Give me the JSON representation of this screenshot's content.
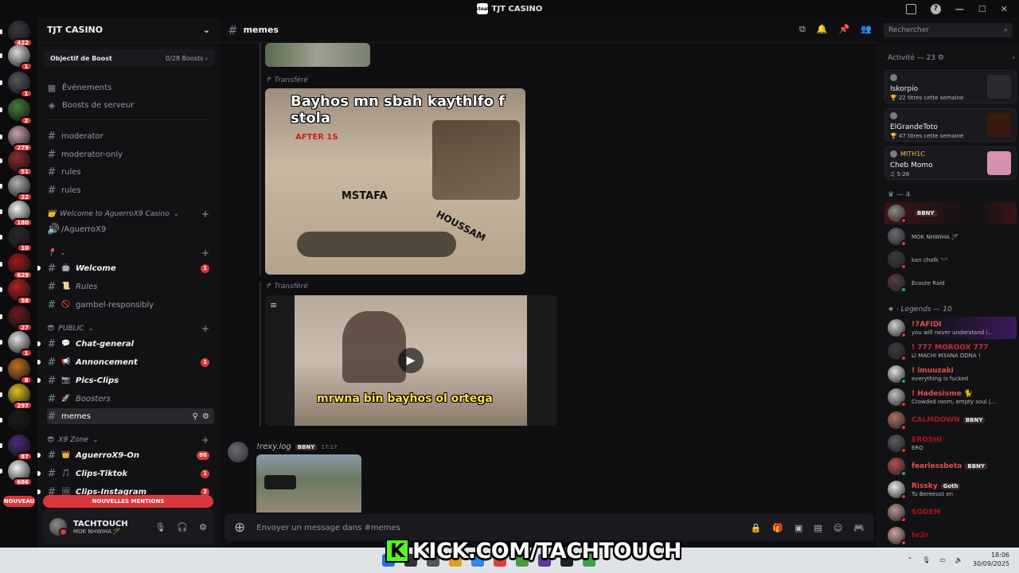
{
  "window": {
    "title": "TJT CASINO"
  },
  "rail": {
    "servers": [
      {
        "badge": "422",
        "color": "#3a3a40"
      },
      {
        "badge": "1",
        "color": "#d9d9d9"
      },
      {
        "badge": "1",
        "color": "#555560"
      },
      {
        "badge": "2",
        "color": "#4a7a3a"
      },
      {
        "badge": "279",
        "color": "#c9a0b0"
      },
      {
        "badge": "51",
        "color": "#8a2a2a"
      },
      {
        "badge": "22",
        "color": "#b0b0b0"
      },
      {
        "badge": "180",
        "color": "#f0f0f0"
      },
      {
        "badge": "10",
        "color": "#2a2a2a"
      },
      {
        "badge": "629",
        "color": "#a01818"
      },
      {
        "badge": "58",
        "color": "#b02020"
      },
      {
        "badge": "27",
        "color": "#6a1a1a"
      },
      {
        "badge": "1",
        "color": "#e0e0e0"
      },
      {
        "badge": "8",
        "color": "#c07020"
      },
      {
        "badge": "297",
        "color": "#e0c020"
      },
      {
        "badge": "",
        "color": "#1a1a1a"
      },
      {
        "badge": "87",
        "color": "#4a2a7a"
      },
      {
        "badge": "686",
        "color": "#f2f2f2"
      }
    ],
    "nouveau": "NOUVEAU"
  },
  "sidebar": {
    "server_name": "TJT CASINO",
    "boost": {
      "label": "Objectif de Boost",
      "count": "0/28 Boosts"
    },
    "nav": [
      {
        "label": "Événements"
      },
      {
        "label": "Boosts de serveur"
      }
    ],
    "channels_top": [
      {
        "label": "moderator"
      },
      {
        "label": "moderator-only"
      },
      {
        "label": "rules"
      },
      {
        "label": "rules"
      }
    ],
    "cat1": "Welcome to AguerroX9 Casino",
    "voice1": "/AguerroX9",
    "cat2_emoji": "📍",
    "group2": [
      {
        "emoji": "🤖",
        "label": "Welcome",
        "badge": "1"
      },
      {
        "emoji": "📜",
        "label": "Rules",
        "badge": ""
      },
      {
        "emoji": "🚫",
        "label": "gambel-responsibly",
        "badge": ""
      }
    ],
    "cat3": "PUBLIC",
    "group3": [
      {
        "emoji": "💬",
        "label": "Chat-general",
        "badge": ""
      },
      {
        "emoji": "📢",
        "label": "Annoncement",
        "badge": "1"
      },
      {
        "emoji": "📷",
        "label": "Pics-Clips",
        "badge": ""
      },
      {
        "emoji": "🚀",
        "label": "Boosters",
        "badge": ""
      }
    ],
    "active_channel": "memes",
    "cat4": "X9 Zone",
    "group4": [
      {
        "emoji": "👑",
        "label": "AguerroX9-On",
        "badge": "86"
      },
      {
        "emoji": "🎵",
        "label": "Clips-Tiktok",
        "badge": "1"
      },
      {
        "emoji": "🖼",
        "label": "Clips-Instagram",
        "badge": "2"
      }
    ],
    "mentions": "NOUVELLES MENTIONS",
    "user": {
      "name": "TACHTOUCH",
      "status": "MOK NHWIHA 🪄"
    }
  },
  "header": {
    "channel": "memes",
    "search_placeholder": "Rechercher"
  },
  "messages": {
    "forwarded_label": "Transféré",
    "meme1_caption_top": "Bayhos mn sbah kaythlfo f stola",
    "meme1_after": "AFTER 1S",
    "meme1_mstafa": "MSTAFA",
    "meme1_houssam": "HOUSSAM",
    "meme2_caption": "mrwna bin bayhos ol ortega",
    "author": "!rexy.log",
    "author_tag": "BBNY",
    "time": "17:17"
  },
  "composer": {
    "placeholder": "Envoyer un message dans #memes"
  },
  "members": {
    "activity_head": "Activité — 23",
    "activities": [
      {
        "user": "",
        "game": "Iskorpio",
        "sub": "22 titres cette semaine",
        "art": "#2a2a30",
        "top_color": "#7a1a1a"
      },
      {
        "user": "",
        "game": "ElGrandeToto",
        "sub": "47 titres cette semaine",
        "art": "#3a1a10",
        "top_color": "#7a1a1a"
      },
      {
        "user": "MITH1C",
        "game": "Cheb Momo",
        "sub": "5:26",
        "art": "#d890b0",
        "top_color": "#e5c04a"
      }
    ],
    "group1_head": "— 4",
    "group1": [
      {
        "name": "",
        "status": "",
        "badge": "BBNY",
        "color": "#c94a4a",
        "av": "#8a8a80",
        "dot": "#da373c",
        "highlight": "#3a1416"
      },
      {
        "name": "",
        "status": "MOK NHWIHA 🪄",
        "badge": "",
        "color": "#c94a4a",
        "av": "#6a6a75",
        "dot": "#da373c",
        "highlight": ""
      },
      {
        "name": "",
        "status": "kan chofk \"-\"",
        "badge": "",
        "color": "#c94a4a",
        "av": "#3a3a40",
        "dot": "#da373c",
        "highlight": ""
      },
      {
        "name": "",
        "status": "Écoute Raid",
        "badge": "",
        "color": "#c94a4a",
        "av": "#5a3a40",
        "dot": "#23a55a",
        "highlight": ""
      }
    ],
    "group2_head": "Legends — 10",
    "group2": [
      {
        "name": "!7AFIDI",
        "status": "you will never understand i...",
        "badge": "",
        "color": "#e05050",
        "av": "#d0d0d0",
        "dot": "#da373c",
        "highlight": "#3a1a5a"
      },
      {
        "name": "! 777 MOROOX 777",
        "status": "LI MACHI M3ANA DDNA !",
        "badge": "",
        "color": "#c0303a",
        "av": "#3a3a40",
        "dot": "#da373c",
        "highlight": ""
      },
      {
        "name": "! imuuzaki",
        "status": "everything is fucked",
        "badge": "",
        "color": "#e05050",
        "av": "#e0e0e0",
        "dot": "#23a55a",
        "highlight": ""
      },
      {
        "name": "! Hadesisme 🐈",
        "status": "Crowded room, empty soul |...",
        "badge": "",
        "color": "#e05050",
        "av": "#c0c0c0",
        "dot": "#da373c",
        "highlight": ""
      },
      {
        "name": "CALMDOWN",
        "status": "",
        "badge": "BBNY",
        "color": "#a01a1a",
        "av": "#b07060",
        "dot": "#da373c",
        "highlight": ""
      },
      {
        "name": "EROSHI",
        "status": "ERO",
        "badge": "",
        "color": "#a01a1a",
        "av": "#5a5a60",
        "dot": "#da373c",
        "highlight": ""
      },
      {
        "name": "fearlessbeta",
        "status": "",
        "badge": "BBNY",
        "color": "#e05050",
        "av": "#b05050",
        "dot": "#23a55a",
        "highlight": ""
      },
      {
        "name": "Rissky",
        "status": "Tu Bereeust en",
        "badge": "Goth",
        "color": "#e05050",
        "av": "#e8e8e8",
        "dot": "#da373c",
        "highlight": ""
      },
      {
        "name": "SODEM",
        "status": "",
        "badge": "",
        "color": "#a01a1a",
        "av": "#c09090",
        "dot": "#da373c",
        "highlight": ""
      },
      {
        "name": "hr2r",
        "status": "",
        "badge": "",
        "color": "#a01a1a",
        "av": "#d0a0a0",
        "dot": "#da373c",
        "highlight": ""
      }
    ]
  },
  "taskbar": {
    "time": "18:06",
    "date": "30/09/2025",
    "overlay": "KICK.COM/TACHTOUCH",
    "overlay_logo": "K"
  }
}
